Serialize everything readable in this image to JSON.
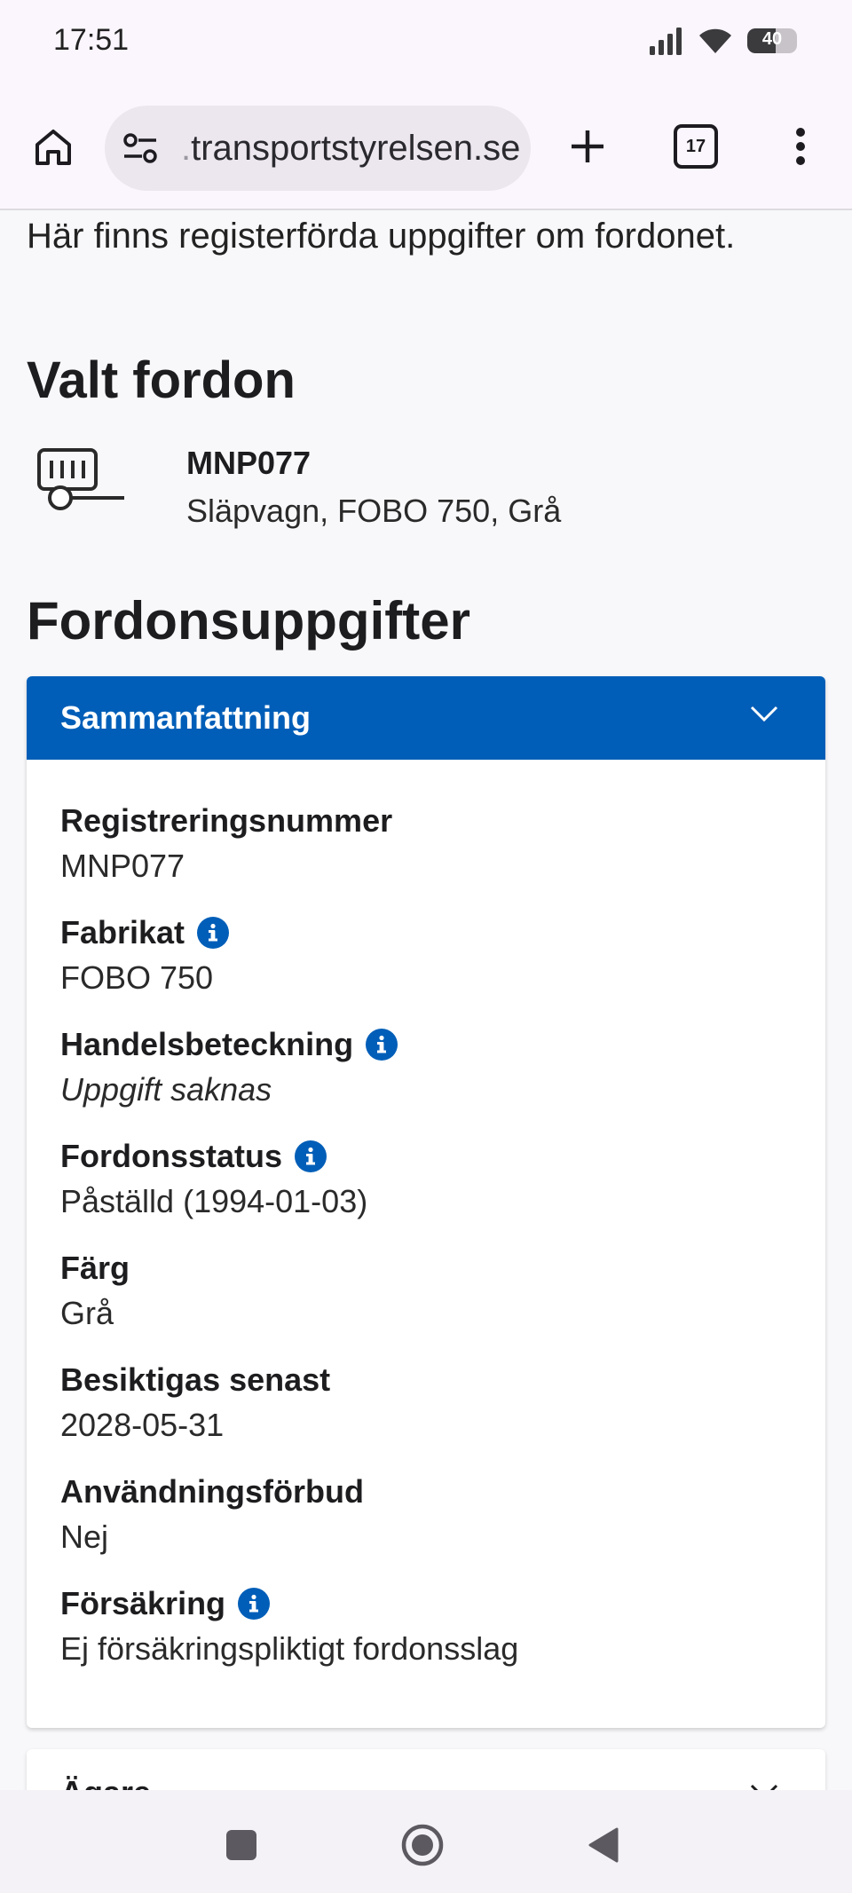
{
  "status_bar": {
    "time": "17:51",
    "battery": "40",
    "icons": [
      "signal-icon",
      "wifi-icon",
      "battery-icon"
    ]
  },
  "browser": {
    "url_prefix": ".",
    "url": "transportstyrelsen.se",
    "tab_count": "17",
    "icons": [
      "home-icon",
      "site-settings-icon",
      "plus-icon",
      "tabs-icon",
      "more-vert-icon"
    ]
  },
  "page": {
    "intro": "Här finns registerförda uppgifter om fordonet.",
    "selected_heading": "Valt fordon",
    "vehicle": {
      "registration": "MNP077",
      "description": "Släpvagn, FOBO 750, Grå",
      "icon": "trailer-icon"
    },
    "details_heading": "Fordonsuppgifter",
    "summary": {
      "title": "Sammanfattning",
      "fields": [
        {
          "label": "Registreringsnummer",
          "value": "MNP077"
        },
        {
          "label": "Fabrikat",
          "value": "FOBO 750"
        },
        {
          "label": "Handelsbeteckning",
          "value": "Uppgift saknas"
        },
        {
          "label": "Fordonsstatus",
          "value": "Påställd (1994-01-03)"
        },
        {
          "label": "Färg",
          "value": "Grå"
        },
        {
          "label": "Besiktigas senast",
          "value": "2028-05-31"
        },
        {
          "label": "Användningsförbud",
          "value": "Nej"
        },
        {
          "label": "Försäkring",
          "value": "Ej försäkringspliktigt fordonsslag"
        }
      ]
    },
    "next_section": {
      "title": "Ägare"
    }
  },
  "colors": {
    "accent": "#005eb8",
    "background": "#f8f8fa",
    "chrome": "#fbf6fd"
  }
}
